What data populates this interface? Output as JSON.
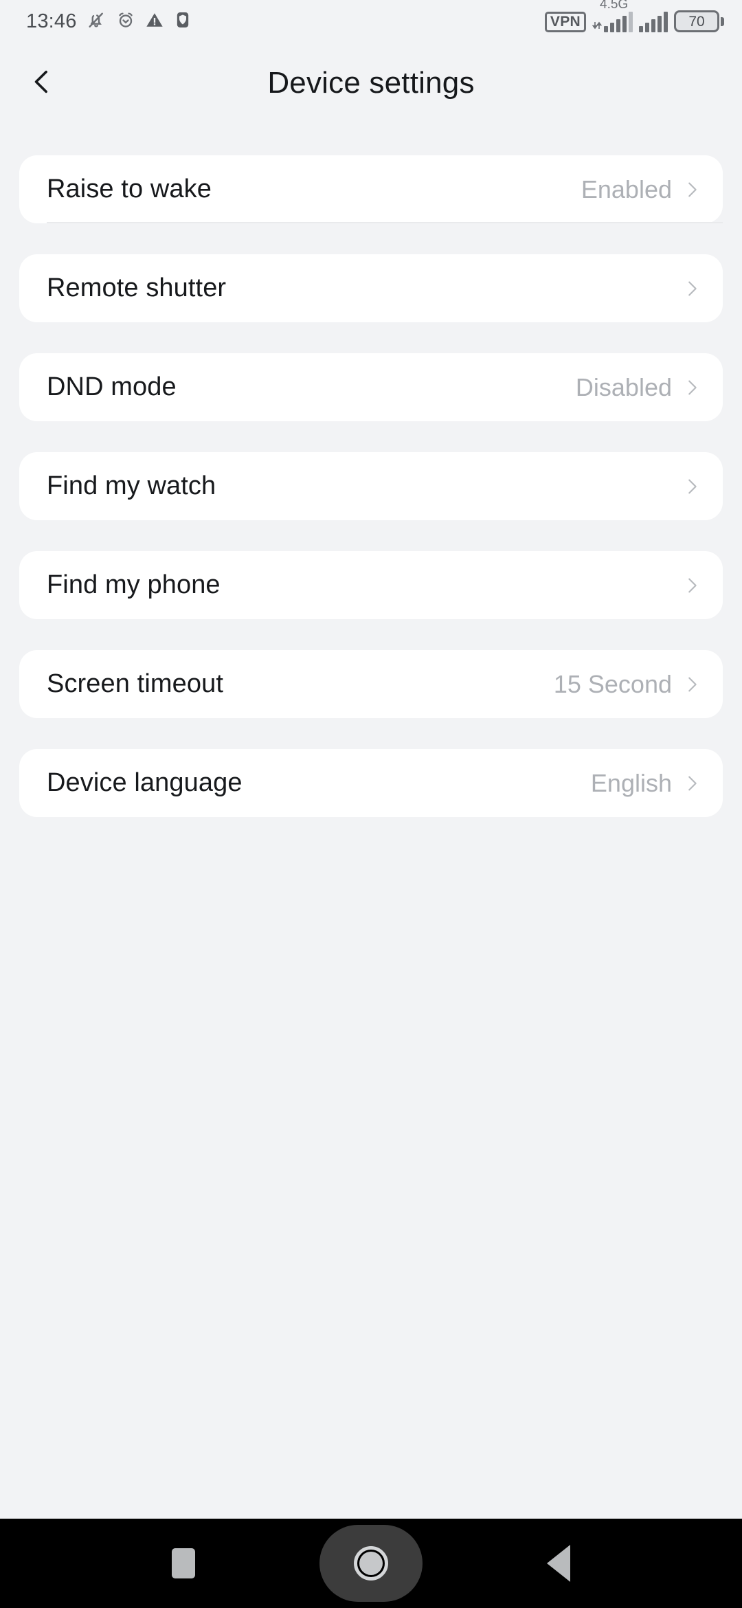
{
  "statusbar": {
    "time": "13:46",
    "icons_left": [
      "bell-muted-icon",
      "alarm-clock-icon",
      "warning-triangle-icon",
      "shield-icon"
    ],
    "vpn_label": "VPN",
    "network_label": "4.5G",
    "battery_level": "70",
    "icons_right": [
      "vpn-badge",
      "signal-bars-sim1",
      "signal-bars-sim2",
      "battery-icon"
    ]
  },
  "header": {
    "back_icon": "chevron-left-icon",
    "title": "Device settings"
  },
  "settings": {
    "items": [
      {
        "label": "Raise to wake",
        "value": "Enabled",
        "chevron": "chevron-right-icon"
      },
      {
        "label": "Remote shutter",
        "value": "",
        "chevron": "chevron-right-icon"
      },
      {
        "label": "DND mode",
        "value": "Disabled",
        "chevron": "chevron-right-icon"
      },
      {
        "label": "Find my watch",
        "value": "",
        "chevron": "chevron-right-icon"
      },
      {
        "label": "Find my phone",
        "value": "",
        "chevron": "chevron-right-icon"
      },
      {
        "label": "Screen timeout",
        "value": "15 Second",
        "chevron": "chevron-right-icon"
      },
      {
        "label": "Device language",
        "value": "English",
        "chevron": "chevron-right-icon"
      }
    ]
  },
  "navbar": {
    "recents_icon": "square-recents-icon",
    "home_icon": "circle-home-icon",
    "back_icon": "triangle-back-icon"
  },
  "colors": {
    "page_background": "#f2f3f5",
    "card_background": "#ffffff",
    "label_text": "#17191c",
    "value_text": "#adb0b5",
    "status_icon": "#6c6f74",
    "navbar_background": "#000000"
  }
}
